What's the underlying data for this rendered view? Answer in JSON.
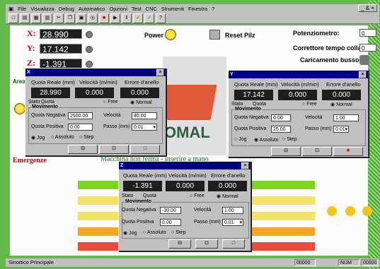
{
  "menu": [
    "File",
    "Visualizza",
    "Debug",
    "Automatico",
    "Opzioni",
    "Test",
    "CNC",
    "Strumenti",
    "Finestra",
    "?"
  ],
  "mdi_controls": "_ & ×",
  "toolbar_icons": [
    "new-icon",
    "open-icon",
    "save-icon",
    "print-icon",
    "cut-icon",
    "copy-icon",
    "paste-icon",
    "zoom-icon",
    "stop-icon",
    "play-icon",
    "step-icon",
    "check-icon",
    "check2-icon",
    "info-icon"
  ],
  "axes": [
    {
      "label": "X:",
      "value": "28.990"
    },
    {
      "label": "Y:",
      "value": "17.142"
    },
    {
      "label": "Z:",
      "value": "-1.391"
    }
  ],
  "controls": {
    "power": "Power",
    "reset": "Reset Pilz",
    "potenziometro": "Potenziometro:",
    "potenziometro_val": "0",
    "correttore": "Correttore tempo colla:",
    "correttore_val": "0",
    "caricamento": "Caricamento bussole"
  },
  "logo_text": "OMAL",
  "area_label": "Area",
  "emergenze": "Emergenze",
  "macchina": "Macchina non ferma - inserire a mano",
  "status_text": "Sinottico Principale",
  "status_num1": "00000",
  "status_num2": "NUM",
  "status_num3": "00000",
  "windows": [
    {
      "title": "X",
      "headers": [
        "Quota Reale (mm)",
        "Velocità (m/min)",
        "Errore d'anello"
      ],
      "values": [
        "28.990",
        "0.000",
        "0.000"
      ],
      "stato": "Stato",
      "quota": "Quota",
      "free": "Free",
      "normal": "Normal",
      "movimento": "Movimento",
      "neg_label": "Quota Negativa",
      "neg_val": "2500.00",
      "vel_label": "Velocità",
      "vel_val": "40.00",
      "pos_label": "Quota Positiva",
      "pos_val": "0.00",
      "passo_label": "Passo (mm)",
      "passo_val": "0.01",
      "jog": "Jog",
      "assoluto": "Assoluto",
      "step": "Step",
      "selected": "Jog"
    },
    {
      "title": "Y",
      "headers": [
        "Quota Reale (mm)",
        "Velocità (m/min)",
        "Errore d'anello"
      ],
      "values": [
        "17.142",
        "0.000",
        "0.000"
      ],
      "stato": "Stato",
      "quota": "Quota",
      "free": "Free",
      "normal": "Normal",
      "movimento": "Movimento",
      "neg_label": "Quota Negativa",
      "neg_val": "0.00",
      "vel_label": "Velocità",
      "vel_val": "1.00",
      "pos_label": "Quota Positiva",
      "pos_val": "25.00",
      "passo_label": "Passo (mm)",
      "passo_val": "0.01",
      "jog": "Jog",
      "assoluto": "Assoluto",
      "step": "Step",
      "selected": "Assoluto"
    },
    {
      "title": "Z",
      "headers": [
        "Quota Reale (mm)",
        "Velocità (m/min)",
        "Errore d'anello"
      ],
      "values": [
        "-1.391",
        "0.000",
        "0.000"
      ],
      "stato": "Stato",
      "quota": "Quota",
      "free": "Free",
      "normal": "Normal",
      "movimento": "Movimento",
      "neg_label": "Quota Negativa",
      "neg_val": "-30.00",
      "vel_label": "Velocità",
      "vel_val": "1.00",
      "pos_label": "Quota Positiva",
      "pos_val": "0.00",
      "passo_label": "Passo (mm)",
      "passo_val": "0.01",
      "jog": "Jog",
      "assoluto": "Assoluto",
      "step": "Step",
      "selected": "Jog"
    }
  ],
  "colors": {
    "accent_red": "#cc0000",
    "titlebar": "#000080",
    "bar_colors": [
      "#7ed321",
      "#f6e26a",
      "#f5a623",
      "#e94b3c"
    ]
  }
}
